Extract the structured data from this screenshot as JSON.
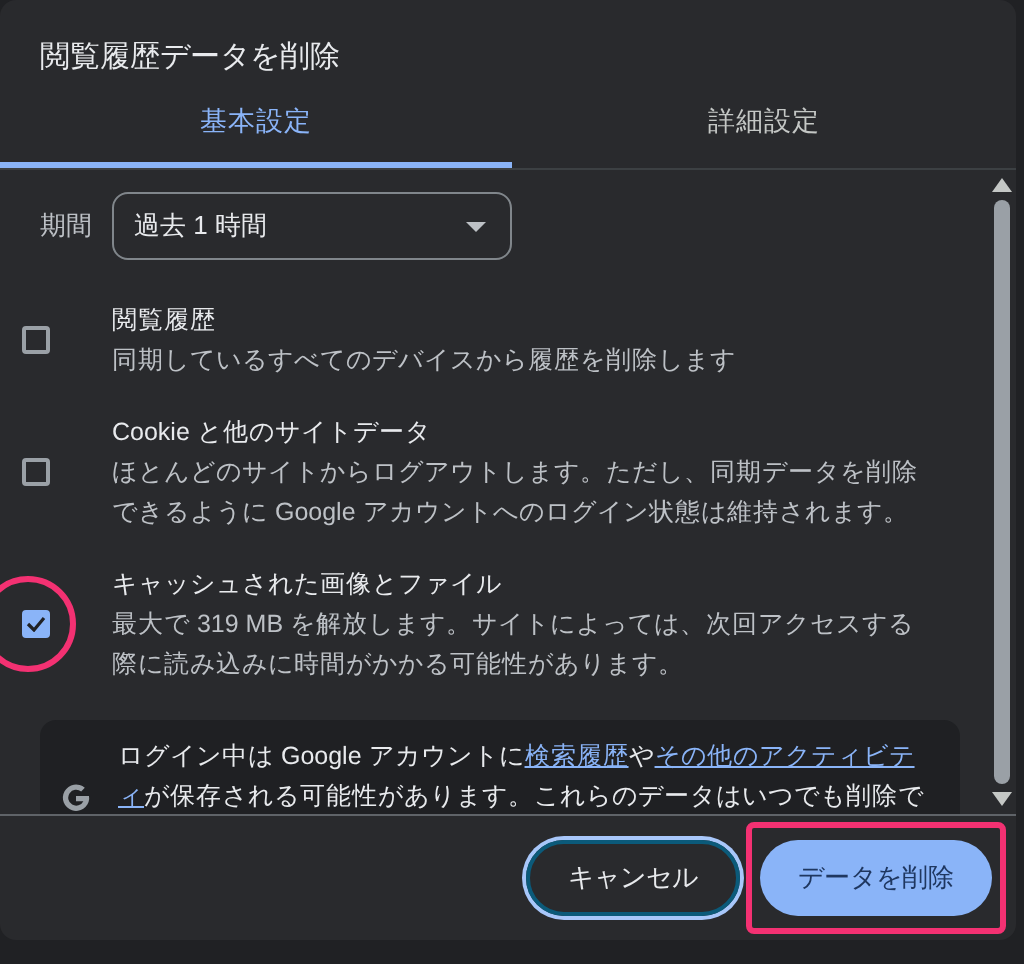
{
  "dialog": {
    "title": "閲覧履歴データを削除"
  },
  "tabs": [
    {
      "label": "基本設定",
      "selected": true
    },
    {
      "label": "詳細設定",
      "selected": false
    }
  ],
  "period": {
    "label": "期間",
    "value": "過去 1 時間"
  },
  "items": [
    {
      "title": "閲覧履歴",
      "description": "同期しているすべてのデバイスから履歴を削除します",
      "checked": false,
      "highlighted": false
    },
    {
      "title": "Cookie と他のサイトデータ",
      "description": "ほとんどのサイトからログアウトします。ただし、同期データを削除できるように Google アカウントへのログイン状態は維持されます。",
      "checked": false,
      "highlighted": false
    },
    {
      "title": "キャッシュされた画像とファイル",
      "description": "最大で 319 MB を解放します。サイトによっては、次回アクセスする際に読み込みに時間がかかる可能性があります。",
      "checked": true,
      "highlighted": true
    }
  ],
  "note": {
    "lines": [
      [
        {
          "text": "ログイン中は Google アカウントに",
          "link": false
        },
        {
          "text": "検索履歴",
          "link": true
        },
        {
          "text": "や",
          "link": false
        },
        {
          "text": "その他のアクティビテ",
          "link": true
        }
      ],
      [
        {
          "text": "ィ",
          "link": true
        },
        {
          "text": "が保存される可能性があります。これらのデータはいつでも削除で",
          "link": false
        }
      ]
    ]
  },
  "buttons": [
    {
      "label": "キャンセル",
      "kind": "outlined",
      "highlighted": false
    },
    {
      "label": "データを削除",
      "kind": "filled",
      "highlighted": true
    }
  ]
}
